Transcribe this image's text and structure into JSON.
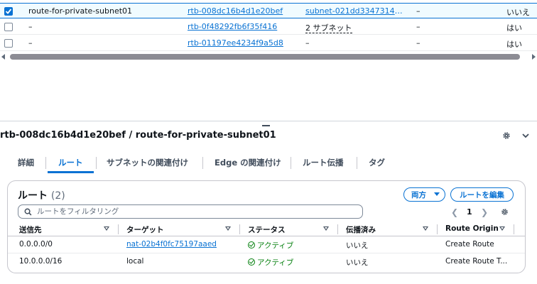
{
  "route_tables": {
    "rows": [
      {
        "selected": true,
        "name": "route-for-private-subnet01",
        "rtb_id": "rtb-008dc16b4d1e20bef",
        "subnets": "subnet-021dd334731431...",
        "edge": "–",
        "main": "いいえ"
      },
      {
        "selected": false,
        "name": "–",
        "rtb_id": "rtb-0f48292fb6f35f416",
        "subnets": "2 サブネット",
        "edge": "–",
        "main": "はい"
      },
      {
        "selected": false,
        "name": "–",
        "rtb_id": "rtb-01197ee4234f9a5d8",
        "subnets": "–",
        "edge": "–",
        "main": "はい"
      }
    ]
  },
  "details": {
    "title": "rtb-008dc16b4d1e20bef / route-for-private-subnet01",
    "tabs": [
      "詳細",
      "ルート",
      "サブネットの関連付け",
      "Edge の関連付け",
      "ルート伝播",
      "タグ"
    ],
    "active_tab": 1
  },
  "routes": {
    "title": "ルート",
    "count": "(2)",
    "filter_button": "両方",
    "edit_button": "ルートを編集",
    "search_placeholder": "ルートをフィルタリング",
    "page": "1",
    "columns": [
      "送信先",
      "ターゲット",
      "ステータス",
      "伝播済み",
      "Route Origin"
    ],
    "rows": [
      {
        "destination": "0.0.0.0/0",
        "target": "nat-02b4f0fc75197aaed",
        "target_link": true,
        "status": "アクティブ",
        "propagated": "いいえ",
        "origin": "Create Route"
      },
      {
        "destination": "10.0.0.0/16",
        "target": "local",
        "target_link": false,
        "status": "アクティブ",
        "propagated": "いいえ",
        "origin": "Create Route T..."
      }
    ]
  },
  "colors": {
    "accent": "#0972d3",
    "success": "#037f0c",
    "text": "#0f141a"
  }
}
